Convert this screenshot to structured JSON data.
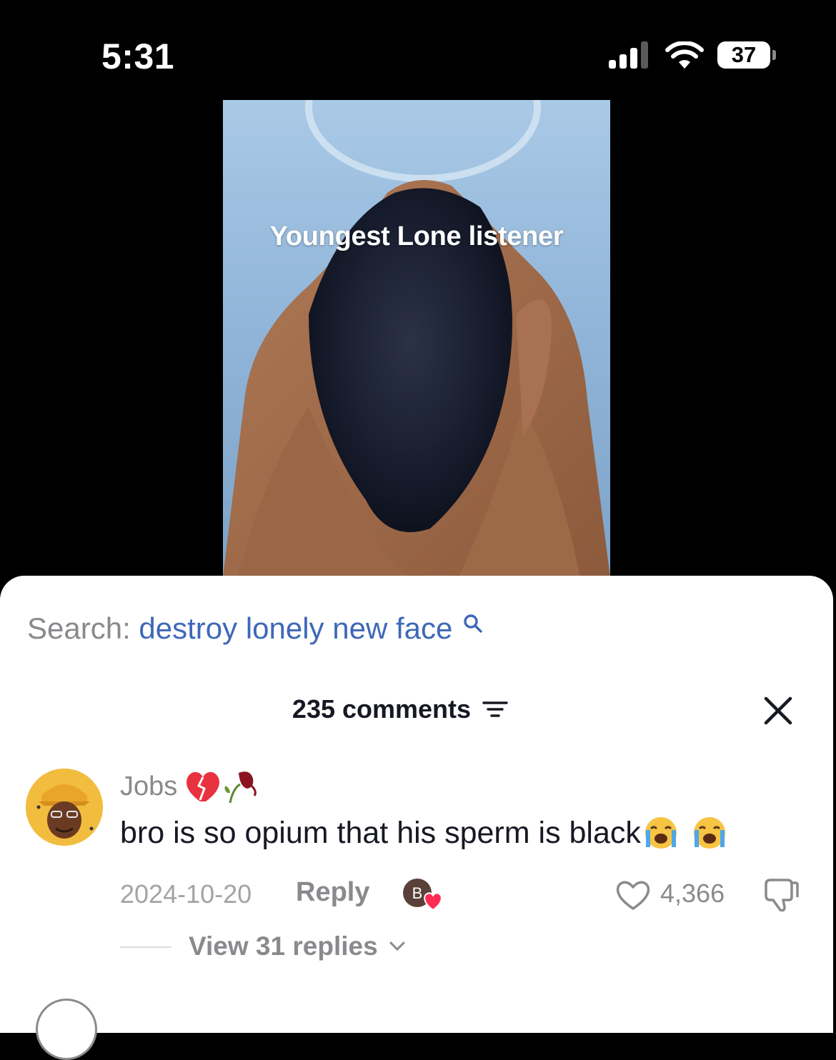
{
  "status_bar": {
    "time": "5:31",
    "battery_level": "37",
    "icons": [
      "cellular-signal-icon",
      "wifi-icon",
      "battery-icon"
    ]
  },
  "video": {
    "caption": "Youngest Lone listener"
  },
  "search": {
    "prefix": "Search:",
    "query": "destroy lonely new face",
    "icon": "search-icon"
  },
  "comments": {
    "count_label": "235 comments",
    "sort_icon": "sort-filter-icon",
    "close_icon": "close-icon"
  },
  "comment": {
    "author": "Jobs",
    "author_emoji": [
      "broken-heart-emoji",
      "wilted-rose-emoji"
    ],
    "text": "bro is so opium that his sperm is black",
    "trailing_emoji": [
      "loudly-crying-face-emoji",
      "loudly-crying-face-emoji"
    ],
    "date": "2024-10-20",
    "reply_label": "Reply",
    "creator_like_initial": "B",
    "like_count": "4,366",
    "view_replies_label": "View 31 replies"
  },
  "colors": {
    "background_top": "#000000",
    "sheet_background": "#ffffff",
    "search_query": "#3e68b8",
    "secondary_text": "#8a8a8e",
    "primary_text": "#161823",
    "heart_accent": "#fe2c55"
  }
}
